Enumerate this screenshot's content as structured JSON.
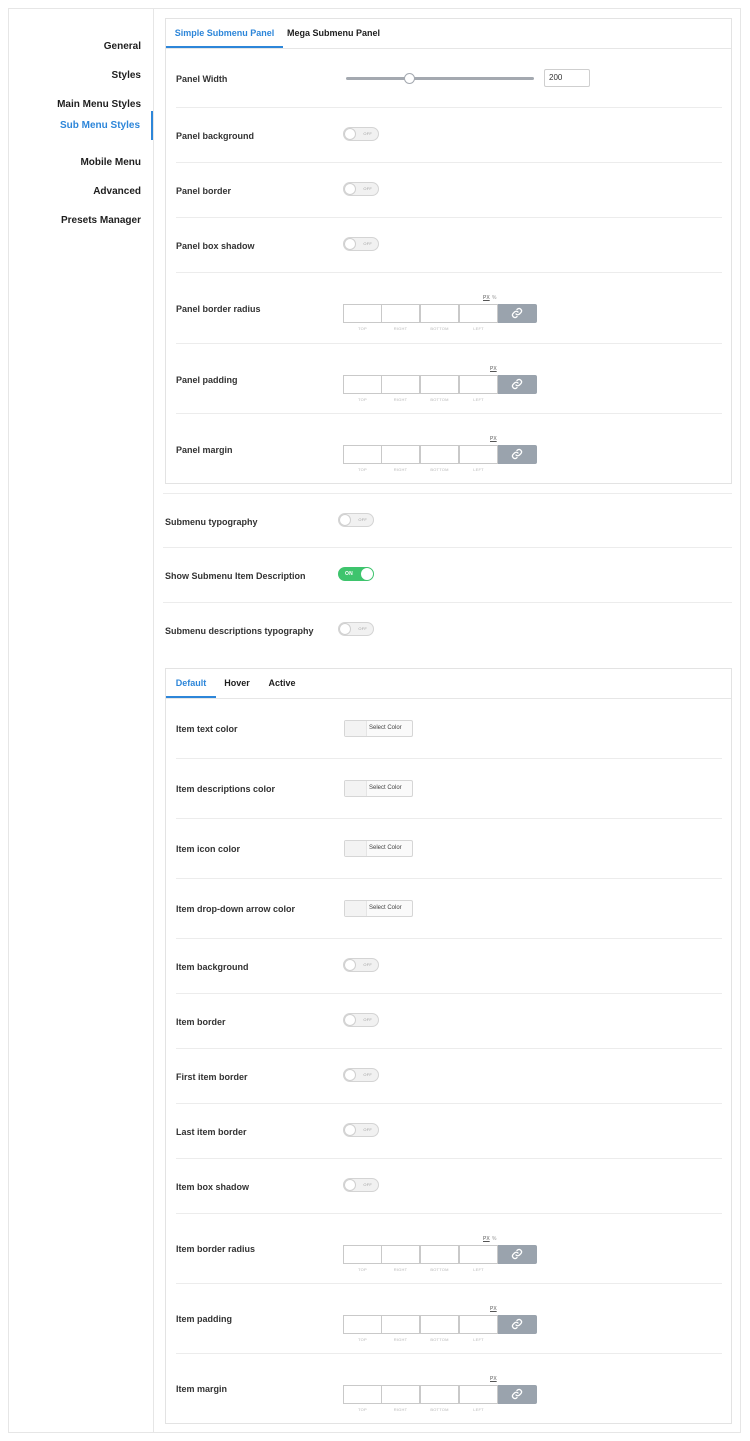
{
  "sidebar": {
    "items": [
      {
        "label": "General"
      },
      {
        "label": "Styles"
      },
      {
        "label": "Main Menu Styles"
      },
      {
        "label": "Sub Menu Styles"
      },
      {
        "label": "Mobile Menu"
      },
      {
        "label": "Advanced"
      },
      {
        "label": "Presets Manager"
      }
    ],
    "active_item": "Sub Menu Styles"
  },
  "panel_tabs": {
    "items": [
      {
        "label": "Simple Submenu Panel"
      },
      {
        "label": "Mega Submenu Panel"
      }
    ],
    "active": "Simple Submenu Panel"
  },
  "panel": {
    "width": {
      "label": "Panel Width",
      "value": "200",
      "slider_fraction": 0.34
    },
    "background": {
      "label": "Panel background",
      "state": "OFF"
    },
    "border": {
      "label": "Panel border",
      "state": "OFF"
    },
    "box_shadow": {
      "label": "Panel box shadow",
      "state": "OFF"
    },
    "border_radius": {
      "label": "Panel border radius"
    },
    "padding": {
      "label": "Panel padding"
    },
    "margin": {
      "label": "Panel margin"
    }
  },
  "dims": {
    "unit_px": "PX",
    "unit_pct": "%",
    "top": "TOP",
    "right": "RIGHT",
    "bottom": "BOTTOM",
    "left": "LEFT"
  },
  "submenu": {
    "typography": {
      "label": "Submenu typography",
      "state": "OFF"
    },
    "show_description": {
      "label": "Show Submenu Item Description",
      "state": "ON"
    },
    "desc_typography": {
      "label": "Submenu descriptions typography",
      "state": "OFF"
    }
  },
  "state_tabs": {
    "items": [
      {
        "label": "Default"
      },
      {
        "label": "Hover"
      },
      {
        "label": "Active"
      }
    ],
    "active": "Default"
  },
  "items": {
    "select_color": "Select Color",
    "text_color": {
      "label": "Item text color"
    },
    "desc_color": {
      "label": "Item descriptions color"
    },
    "icon_color": {
      "label": "Item icon color"
    },
    "arrow_color": {
      "label": "Item drop-down arrow color"
    },
    "background": {
      "label": "Item background",
      "state": "OFF"
    },
    "border": {
      "label": "Item border",
      "state": "OFF"
    },
    "first_border": {
      "label": "First item border",
      "state": "OFF"
    },
    "last_border": {
      "label": "Last item border",
      "state": "OFF"
    },
    "box_shadow": {
      "label": "Item box shadow",
      "state": "OFF"
    },
    "border_radius": {
      "label": "Item border radius"
    },
    "padding": {
      "label": "Item padding"
    },
    "margin": {
      "label": "Item margin"
    }
  },
  "colors": {
    "accent": "#2d86d9",
    "toggle_on": "#3ec46d",
    "link_button": "#9aa3ad"
  }
}
